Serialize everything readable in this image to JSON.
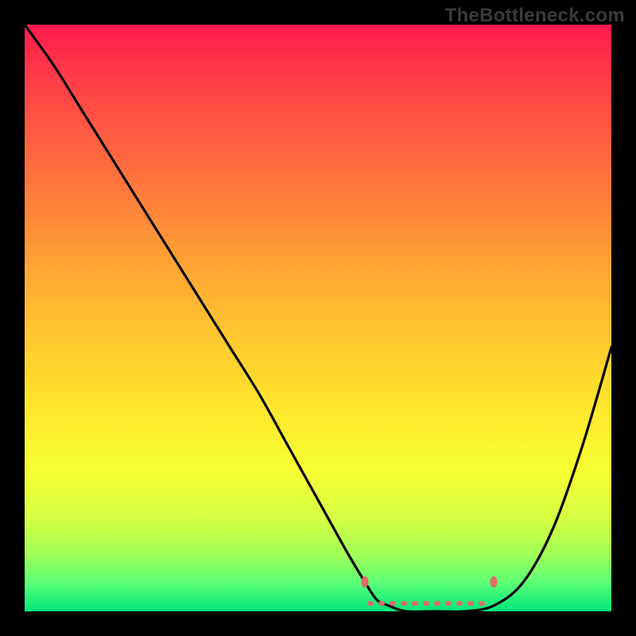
{
  "watermark": "TheBottleneck.com",
  "chart_data": {
    "type": "line",
    "title": "",
    "xlabel": "",
    "ylabel": "",
    "xlim": [
      0,
      100
    ],
    "ylim": [
      0,
      100
    ],
    "grid": false,
    "series": [
      {
        "name": "curve",
        "x": [
          0,
          5,
          10,
          15,
          20,
          25,
          30,
          35,
          40,
          45,
          50,
          55,
          58,
          60,
          62,
          65,
          70,
          75,
          80,
          85,
          90,
          95,
          100
        ],
        "y": [
          100,
          93,
          85,
          77,
          69,
          61,
          53,
          45,
          37,
          28,
          19,
          10,
          5,
          2,
          1,
          0,
          0,
          0,
          1,
          5,
          14,
          28,
          45
        ]
      }
    ],
    "annotations": [
      {
        "name": "marker-left",
        "x": 58,
        "y": 5
      },
      {
        "name": "marker-right",
        "x": 80,
        "y": 5
      }
    ],
    "colors": {
      "curve_stroke": "#000000",
      "marker_fill": "#e26a6a",
      "gradient_top": "#ff1a4d",
      "gradient_bottom": "#00e87a"
    }
  }
}
